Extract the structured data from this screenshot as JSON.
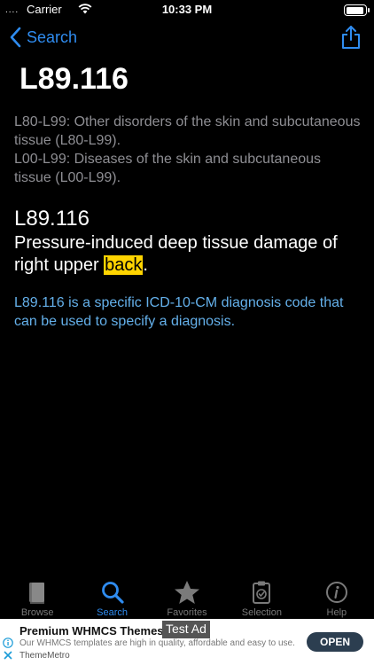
{
  "status_bar": {
    "carrier": "Carrier",
    "time": "10:33 PM",
    "signal": "....",
    "battery_level": 0.85
  },
  "nav": {
    "back_label": "Search",
    "back_icon": "chevron-left-icon",
    "share_icon": "share-icon",
    "accent_color": "#2f8cf0"
  },
  "content": {
    "code": "L89.116",
    "hierarchy": [
      "L80-L99: Other disorders of the skin and subcutaneous tissue (L80-L99).",
      "L00-L99: Diseases of the skin and subcutaneous tissue (L00-L99)."
    ],
    "code_heading": "L89.116",
    "description_before": "Pressure-induced deep tissue damage of right upper ",
    "description_highlight": "back",
    "description_after": ".",
    "info": "L89.116 is a specific ICD-10-CM diagnosis code that can be used to specify a diagnosis.",
    "highlight_color": "#ffd400",
    "info_color": "#64b0ea"
  },
  "tabs": [
    {
      "label": "Browse",
      "icon": "book-icon",
      "active": false
    },
    {
      "label": "Search",
      "icon": "search-icon",
      "active": true
    },
    {
      "label": "Favorites",
      "icon": "star-icon",
      "active": false
    },
    {
      "label": "Selection",
      "icon": "clipboard-icon",
      "active": false
    },
    {
      "label": "Help",
      "icon": "info-icon",
      "active": false
    }
  ],
  "ad": {
    "title": "Premium WHMCS Themes",
    "body": "Our WHMCS templates are high in quality, affordable and easy to use.",
    "source": "ThemeMetro",
    "button_label": "OPEN",
    "tag": "Test Ad"
  }
}
